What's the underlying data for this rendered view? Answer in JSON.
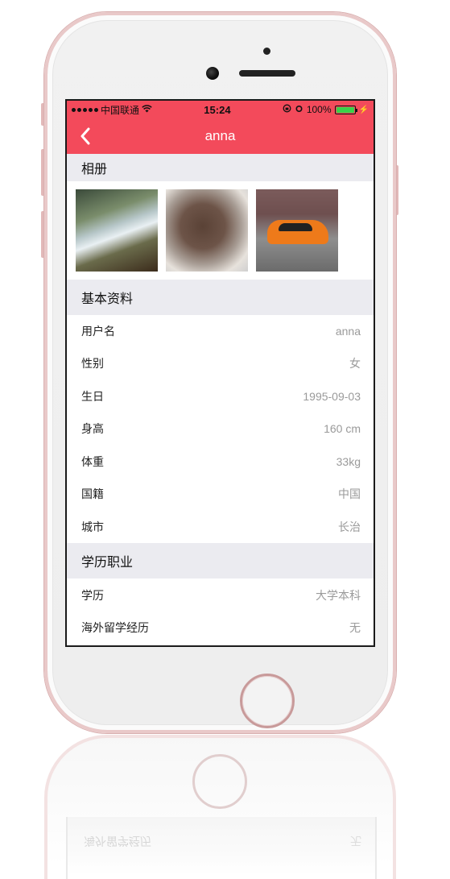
{
  "status_bar": {
    "carrier": "中国联通",
    "time": "15:24",
    "battery": "100%"
  },
  "nav": {
    "title": "anna",
    "back_icon": "chevron-left-icon"
  },
  "colors": {
    "accent": "#f34a5b",
    "section_bg": "#ebebf0",
    "value_text": "#9a9a9a"
  },
  "album": {
    "header": "相册",
    "photos": [
      "waterfall-photo",
      "food-photo",
      "orange-sports-car-photo"
    ]
  },
  "basic_info": {
    "header": "基本资料",
    "rows": [
      {
        "label": "用户名",
        "value": "anna"
      },
      {
        "label": "性别",
        "value": "女"
      },
      {
        "label": "生日",
        "value": "1995-09-03"
      },
      {
        "label": "身高",
        "value": "160 cm"
      },
      {
        "label": "体重",
        "value": "33kg"
      },
      {
        "label": "国籍",
        "value": "中国"
      },
      {
        "label": "城市",
        "value": "长治"
      }
    ]
  },
  "education": {
    "header": "学历职业",
    "rows": [
      {
        "label": "学历",
        "value": "大学本科"
      },
      {
        "label": "海外留学经历",
        "value": "无"
      }
    ]
  }
}
